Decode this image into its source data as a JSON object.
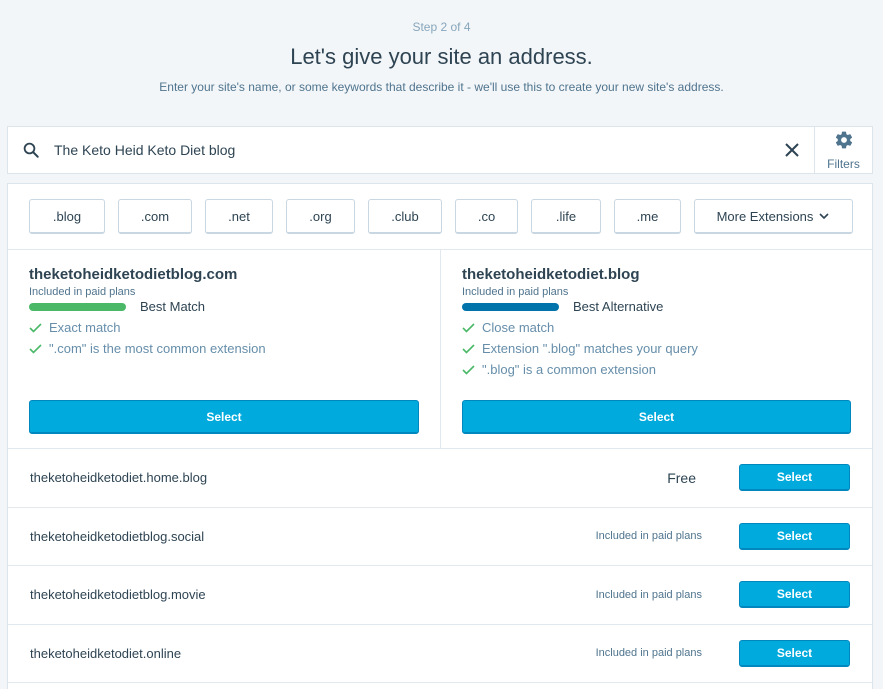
{
  "header": {
    "step": "Step 2 of 4",
    "title": "Let's give your site an address.",
    "subtitle": "Enter your site's name, or some keywords that describe it - we'll use this to create your new site's address."
  },
  "search": {
    "value": "The Keto Heid Keto Diet blog",
    "filters_label": "Filters"
  },
  "extensions": [
    ".blog",
    ".com",
    ".net",
    ".org",
    ".club",
    ".co",
    ".life",
    ".me"
  ],
  "more_extensions_label": "More Extensions",
  "featured": [
    {
      "domain": "theketoheidketodietblog.com",
      "included": "Included in paid plans",
      "match_label": "Best Match",
      "match_color": "#4ab866",
      "reasons": [
        "Exact match",
        "\".com\" is the most common extension"
      ],
      "select_label": "Select"
    },
    {
      "domain": "theketoheidketodiet.blog",
      "included": "Included in paid plans",
      "match_label": "Best Alternative",
      "match_color": "#0073aa",
      "reasons": [
        "Close match",
        "Extension \".blog\" matches your query",
        "\".blog\" is a common extension"
      ],
      "select_label": "Select"
    }
  ],
  "results": [
    {
      "domain": "theketoheidketodiet.home.blog",
      "price": "Free",
      "select_label": "Select"
    },
    {
      "domain": "theketoheidketodietblog.social",
      "price": "Included in paid plans",
      "select_label": "Select"
    },
    {
      "domain": "theketoheidketodietblog.movie",
      "price": "Included in paid plans",
      "select_label": "Select"
    },
    {
      "domain": "theketoheidketodiet.online",
      "price": "Included in paid plans",
      "select_label": "Select"
    }
  ],
  "colors": {
    "accent": "#00aadc",
    "check": "#4ab866"
  }
}
